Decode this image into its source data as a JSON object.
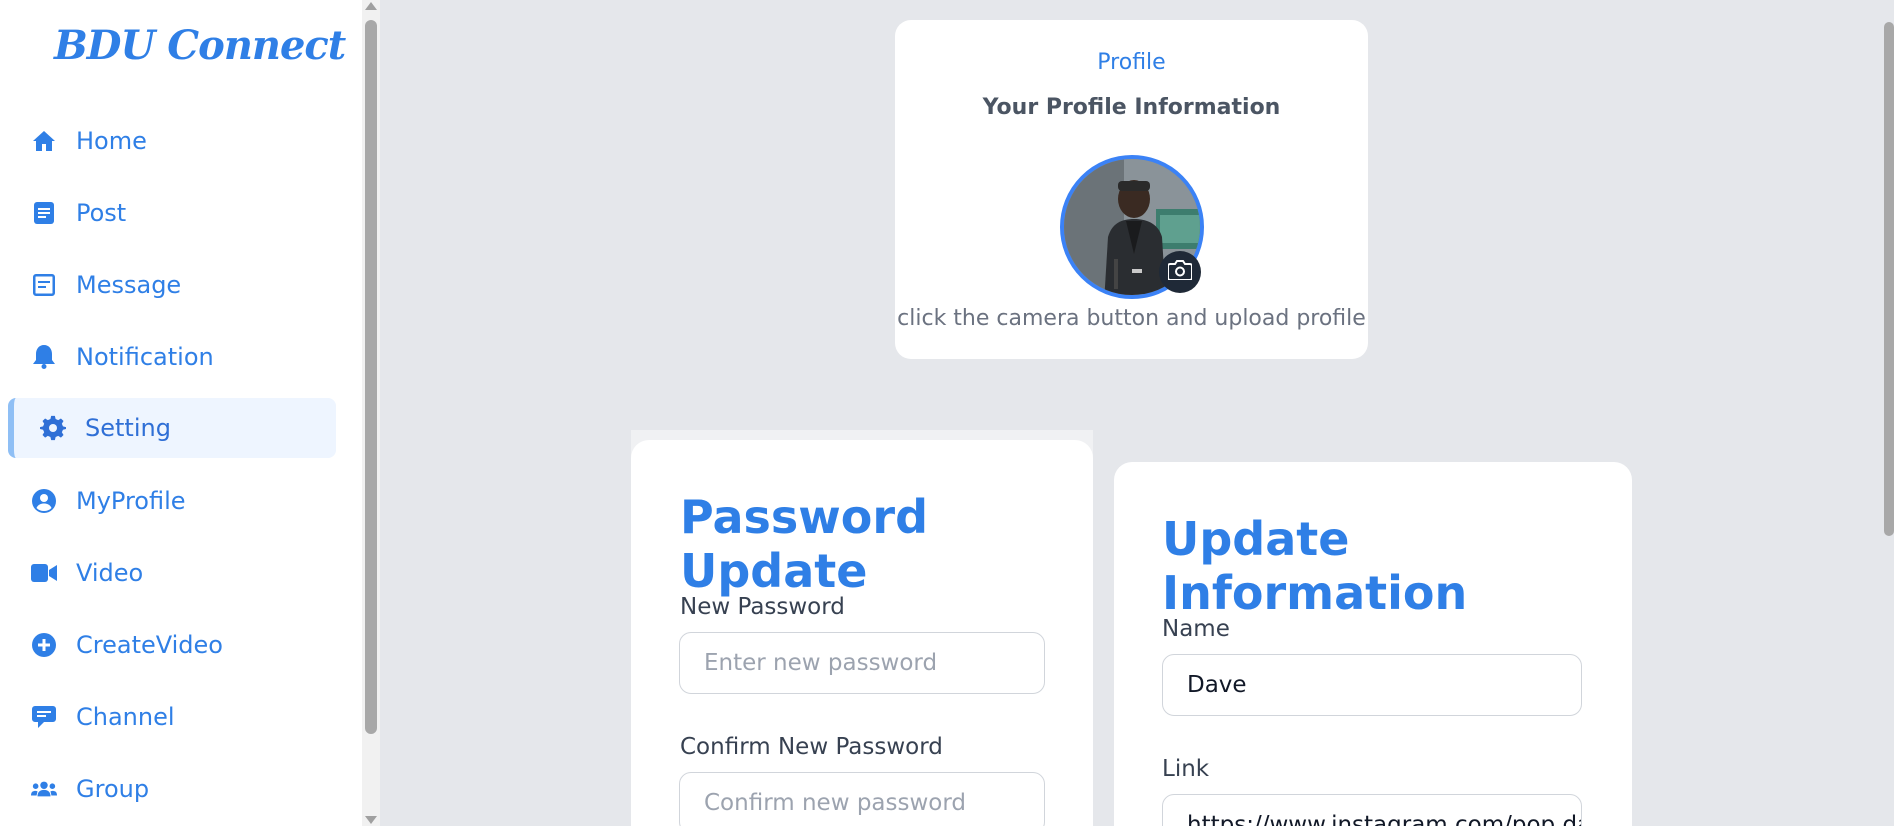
{
  "brand": "BDU Connect",
  "sidebar": {
    "items": [
      {
        "label": "Home",
        "icon": "home-icon"
      },
      {
        "label": "Post",
        "icon": "post-icon"
      },
      {
        "label": "Message",
        "icon": "message-icon"
      },
      {
        "label": "Notification",
        "icon": "bell-icon"
      },
      {
        "label": "Setting",
        "icon": "gear-icon",
        "active": true
      },
      {
        "label": "MyProfile",
        "icon": "user-circle-icon"
      },
      {
        "label": "Video",
        "icon": "video-camera-icon"
      },
      {
        "label": "CreateVideo",
        "icon": "plus-circle-icon"
      },
      {
        "label": "Channel",
        "icon": "comment-icon"
      },
      {
        "label": "Group",
        "icon": "users-icon"
      }
    ]
  },
  "profile": {
    "heading": "Profile",
    "subheading": "Your Profile Information",
    "hint": "click the camera button and upload profile"
  },
  "password_update": {
    "title": "Password Update",
    "new_label": "New Password",
    "new_placeholder": "Enter new password",
    "confirm_label": "Confirm New Password",
    "confirm_placeholder": "Confirm new password"
  },
  "update_info": {
    "title": "Update Information",
    "name_label": "Name",
    "name_value": "Dave",
    "link_label": "Link",
    "link_value": "https://www.instagram.com/pop.da"
  },
  "colors": {
    "accent": "#2f7fe6",
    "active_bg": "#eef5ff",
    "page_bg": "#e5e7eb"
  }
}
